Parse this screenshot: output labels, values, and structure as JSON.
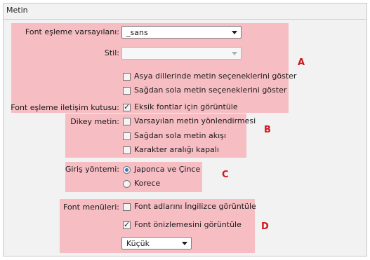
{
  "section_title": "Metin",
  "groupA": {
    "letter": "A",
    "font_mapping_label": "Font eşleme varsayılanı:",
    "font_mapping_value": "_sans",
    "style_label": "Stil:",
    "style_value": "",
    "asian_option": "Asya dillerinde metin seçeneklerini göster",
    "rtl_option": "Sağdan sola metin seçeneklerini göster",
    "dialog_label": "Font eşleme iletişim kutusu:",
    "missing_fonts_option": "Eksik fontlar için görüntüle"
  },
  "groupB": {
    "letter": "B",
    "vertical_label": "Dikey metin:",
    "default_orientation_option": "Varsayılan metin yönlendirmesi",
    "rtl_flow_option": "Sağdan sola metin akışı",
    "kerning_off_option": "Karakter aralığı kapalı"
  },
  "groupC": {
    "letter": "C",
    "input_label": "Giriş yöntemi:",
    "japanese_chinese": "Japonca ve Çince",
    "korean": "Korece"
  },
  "groupD": {
    "letter": "D",
    "menus_label": "Font menüleri:",
    "english_names_option": "Font adlarını İngilizce görüntüle",
    "preview_option": "Font önizlemesini görüntüle",
    "preview_size": "Küçük"
  },
  "colors": {
    "highlight": "#f6b9c0",
    "letter": "#d0161b"
  }
}
